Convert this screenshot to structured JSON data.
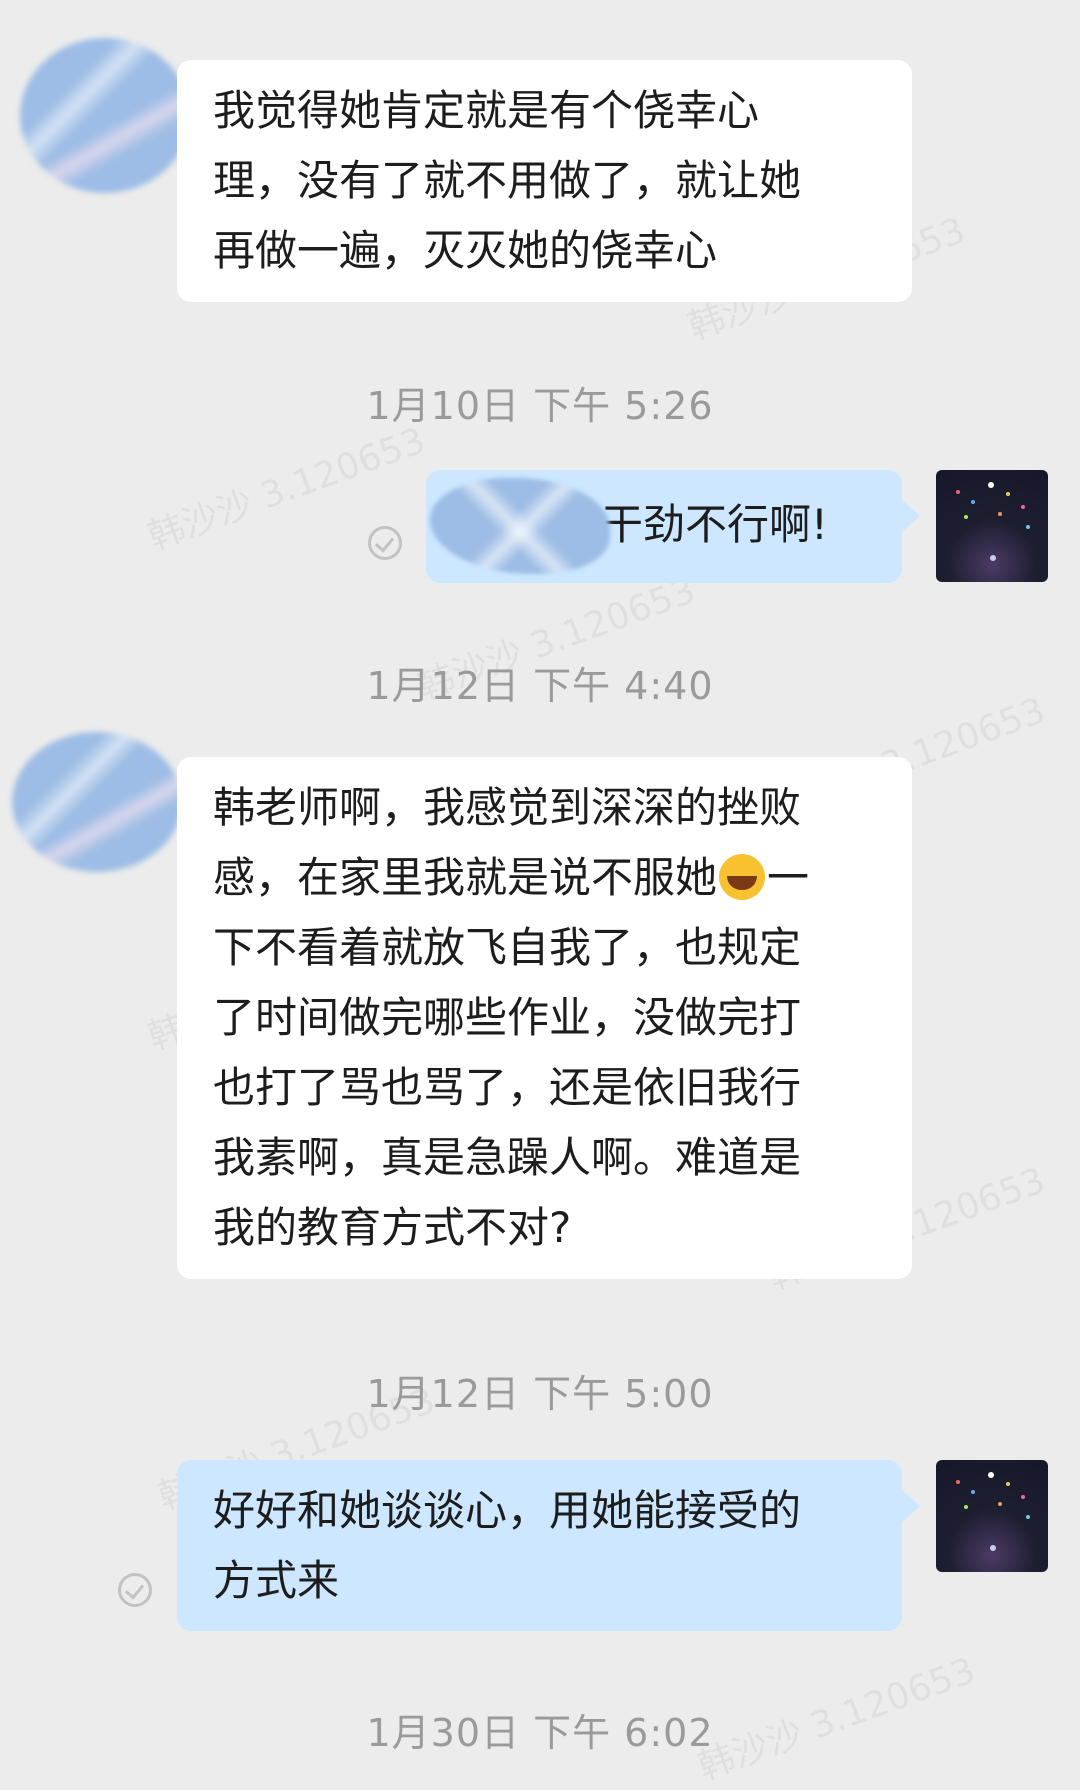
{
  "watermark": "韩沙沙 3.120653",
  "messages": [
    {
      "direction": "incoming",
      "lines": [
        "我觉得她肯定就是有个侥幸心",
        "理，没有了就不用做了，就让她",
        "再做一遍，灭灭她的侥幸心"
      ]
    },
    {
      "timestamp": "1月10日  下午 5:26"
    },
    {
      "direction": "outgoing",
      "status_icon": "sent-check-icon",
      "text": "干劲不行啊!"
    },
    {
      "timestamp": "1月12日  下午 4:40"
    },
    {
      "direction": "incoming",
      "lines": [
        "韩老师啊，我感觉到深深的挫败",
        "感，在家里我就是说不服她",
        "一",
        "下不看着就放飞自我了，也规定",
        "了时间做完哪些作业，没做完打",
        "也打了骂也骂了，还是依旧我行",
        "我素啊，真是急躁人啊。难道是",
        "我的教育方式不对?"
      ],
      "emoji": "crying-face-emoji"
    },
    {
      "timestamp": "1月12日  下午 5:00"
    },
    {
      "direction": "outgoing",
      "status_icon": "sent-check-icon",
      "lines": [
        "好好和她谈谈心，用她能接受的",
        "方式来"
      ]
    },
    {
      "timestamp": "1月30日  下午 6:02"
    }
  ]
}
